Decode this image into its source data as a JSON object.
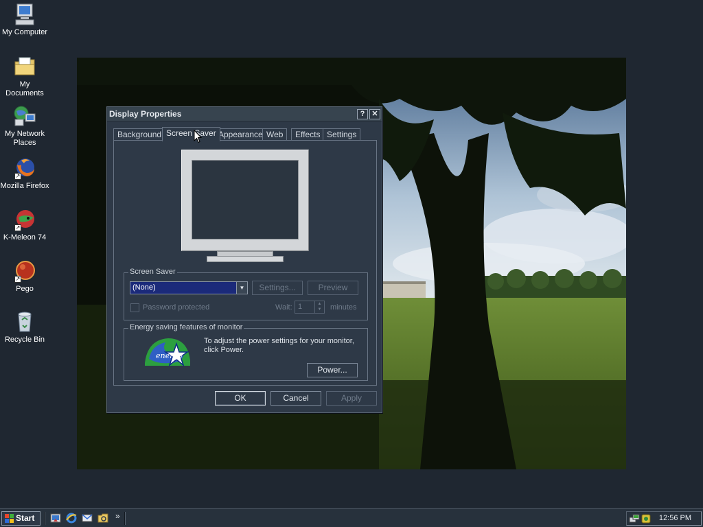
{
  "desktop": {
    "icons": [
      {
        "label": "My Computer",
        "icon": "computer-icon"
      },
      {
        "label": "My Documents",
        "icon": "folder-icon"
      },
      {
        "label": "My Network Places",
        "icon": "network-icon"
      },
      {
        "label": "Mozilla Firefox",
        "icon": "firefox-icon"
      },
      {
        "label": "K-Meleon 74",
        "icon": "kmeleon-icon"
      },
      {
        "label": "Pego",
        "icon": "pego-icon"
      },
      {
        "label": "Recycle Bin",
        "icon": "recycle-bin-icon"
      }
    ]
  },
  "window": {
    "title": "Display Properties",
    "help_glyph": "?",
    "close_glyph": "✕",
    "tabs": [
      "Background",
      "Screen Saver",
      "Appearance",
      "Web",
      "Effects",
      "Settings"
    ],
    "active_tab": "Screen Saver",
    "screensaver": {
      "group_label": "Screen Saver",
      "selected": "(None)",
      "settings_label": "Settings...",
      "preview_label": "Preview",
      "password_label": "Password protected",
      "wait_label": "Wait:",
      "wait_value": "1",
      "minutes_label": "minutes"
    },
    "energy": {
      "group_label": "Energy saving features of monitor",
      "text": "To adjust the power settings for your monitor, click Power.",
      "power_label": "Power...",
      "logo_text": "energy"
    },
    "buttons": {
      "ok": "OK",
      "cancel": "Cancel",
      "apply": "Apply"
    }
  },
  "taskbar": {
    "start_label": "Start",
    "chevron": "»",
    "clock": "12:56 PM"
  },
  "colors": {
    "desktop_bg": "#1f2731",
    "window_bg": "#2e3947",
    "selection": "#1b2a7a",
    "wallpaper_sky": "#9fb6cc",
    "wallpaper_grass": "#5a7a2a"
  }
}
